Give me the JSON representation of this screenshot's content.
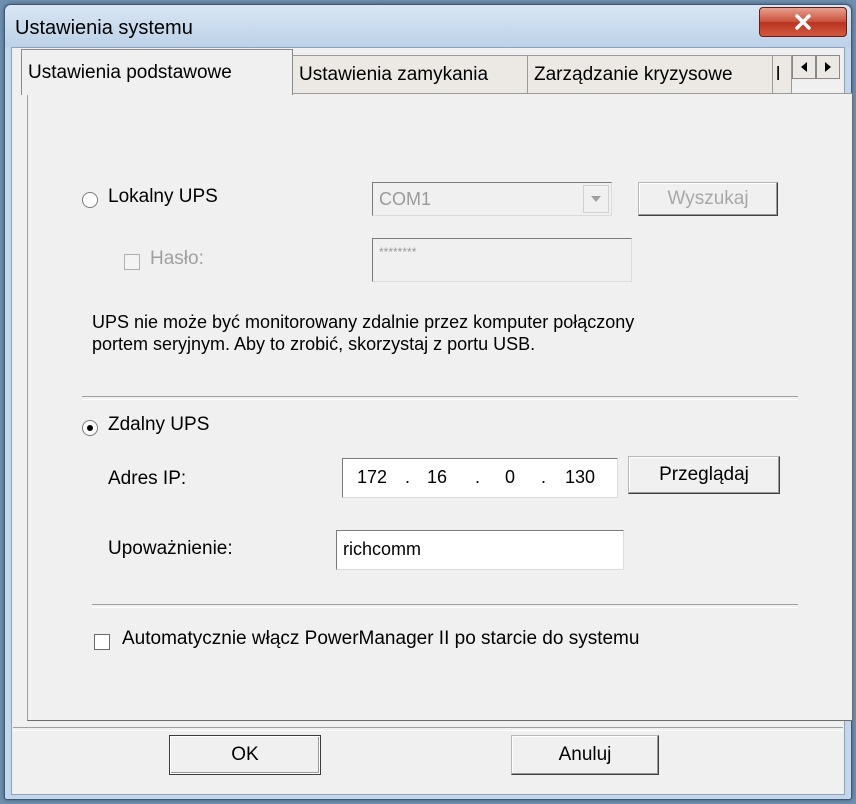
{
  "window": {
    "title": "Ustawienia systemu"
  },
  "tabs": [
    {
      "label": "Ustawienia podstawowe",
      "active": true
    },
    {
      "label": "Ustawienia zamykania",
      "active": false
    },
    {
      "label": "Zarządzanie kryzysowe",
      "active": false
    },
    {
      "label": "l",
      "active": false
    }
  ],
  "local": {
    "radio_label": "Lokalny UPS",
    "port_value": "COM1",
    "search_label": "Wyszukaj",
    "password_label": "Hasło:",
    "password_value": "********",
    "note_line1": "UPS nie może być monitorowany zdalnie przez komputer połączony",
    "note_line2": "portem seryjnym. Aby to zrobić, skorzystaj z portu USB."
  },
  "remote": {
    "radio_label": "Zdalny UPS",
    "ip_label": "Adres IP:",
    "ip": [
      "172",
      "16",
      "0",
      "130"
    ],
    "ip_dot": ".",
    "browse_label": "Przeglądaj",
    "auth_label": "Upoważnienie:",
    "auth_value": "richcomm"
  },
  "autostart_label": "Automatycznie włącz PowerManager II po starcie do systemu",
  "footer": {
    "ok_label": "OK",
    "cancel_label": "Anuluj"
  }
}
